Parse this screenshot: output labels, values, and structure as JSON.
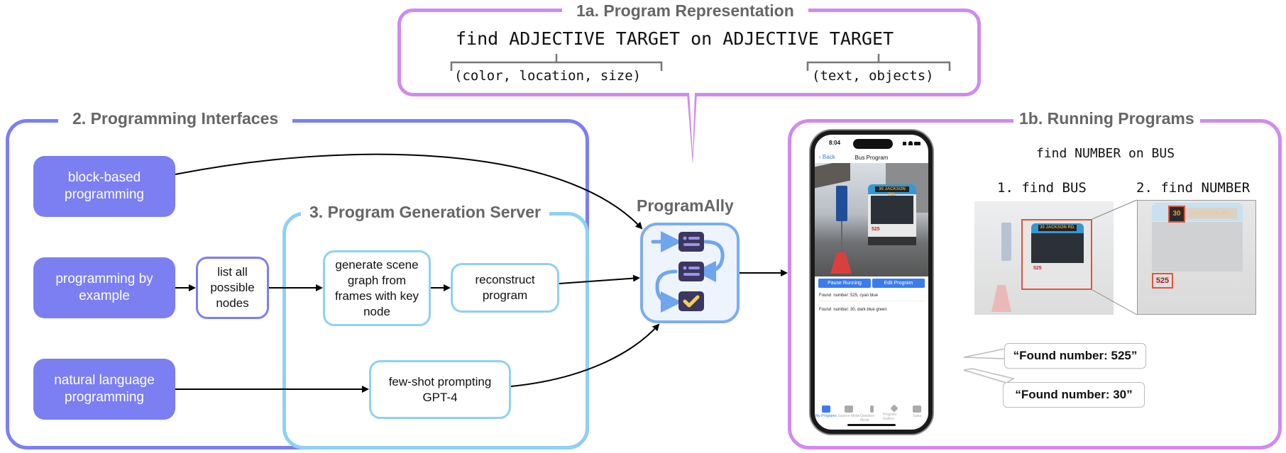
{
  "sections": {
    "representation": {
      "title": "1a. Program Representation",
      "program": "find ADJECTIVE TARGET on ADJECTIVE TARGET",
      "adjective_options": "(color, location, size)",
      "target_options": "(text, objects)",
      "color": "#d08af0"
    },
    "interfaces": {
      "title": "2. Programming Interfaces",
      "color": "#7b7ff2",
      "items": [
        {
          "label": "block-based programming"
        },
        {
          "label": "programming by example"
        },
        {
          "label": "natural language programming"
        }
      ],
      "list_nodes": "list all possible nodes"
    },
    "server": {
      "title": "3.  Program Generation Server",
      "color": "#8fd0f5",
      "steps": {
        "scene_graph": "generate scene graph from frames with key node",
        "reconstruct": "reconstruct program",
        "few_shot": "few-shot prompting GPT-4"
      }
    },
    "app": {
      "name": "ProgramAlly",
      "icon": "program-flow-icon",
      "border_color": "#7aaef0"
    },
    "running": {
      "title": "1b. Running Programs",
      "color": "#d08af0",
      "program": "find NUMBER on BUS",
      "step1": "1. find BUS",
      "step2": "2. find NUMBER",
      "detections": [
        "30",
        "525"
      ],
      "bus_sign": "JACKSON RD.",
      "callouts": [
        "“Found number: 525”",
        "“Found number: 30”"
      ]
    }
  },
  "phone": {
    "time": "8:04",
    "back_label": "Back",
    "screen_title": "Bus Program",
    "pause_button": "Pause Running",
    "edit_button": "Edit Program",
    "results": [
      "Found  number: 525, cyan blue",
      "Found  number: 30, dark blue green"
    ],
    "tabs": [
      {
        "label": "My Programs",
        "active": true
      },
      {
        "label": "Explore Mode"
      },
      {
        "label": "Question Mode"
      },
      {
        "label": "Program Gallery"
      },
      {
        "label": "Tasks"
      }
    ],
    "accent": "#3a7bf0"
  }
}
